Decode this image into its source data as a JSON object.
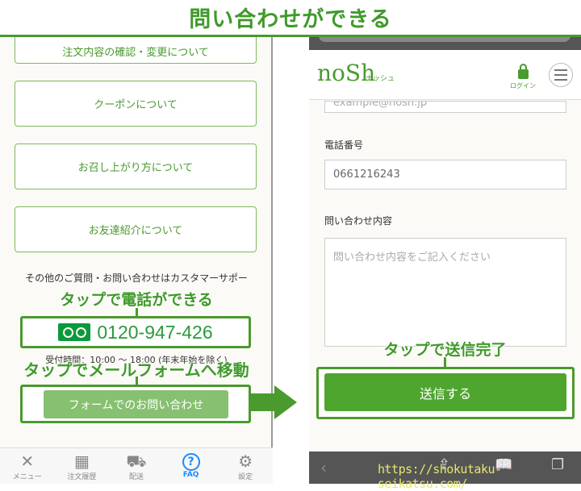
{
  "banner": "問い合わせができる",
  "left": {
    "faq_buttons": [
      "注文内容の確認・変更について",
      "クーポンについて",
      "お召し上がり方について",
      "お友達紹介について"
    ],
    "other_text": "その他のご質問・お問い合わせはカスタマーサポー",
    "phone": "0120-947-426",
    "hours": "受付時間：10:00 〜 18:00 (年末年始を除く)",
    "form_button": "フォームでのお問い合わせ",
    "anno_phone": "タップで電話ができる",
    "anno_form": "タップでメールフォームへ移動",
    "tabs": [
      {
        "label": "メニュー",
        "icon": "utensils-icon"
      },
      {
        "label": "注文履歴",
        "icon": "calendar-icon"
      },
      {
        "label": "配送",
        "icon": "truck-icon"
      },
      {
        "label": "FAQ",
        "icon": "question-icon",
        "active": true
      },
      {
        "label": "設定",
        "icon": "gear-icon"
      }
    ],
    "active_color": "#1a8cff"
  },
  "right": {
    "logo": "noSh",
    "logo_kana": "ナッシュ",
    "login": "ログイン",
    "email_value": "example@nosh.jp",
    "phone_label": "電話番号",
    "phone_value": "0661216243",
    "inquiry_label": "問い合わせ内容",
    "inquiry_placeholder": "問い合わせ内容をご記入ください",
    "submit": "送信する",
    "anno_submit": "タップで送信完了",
    "url": "https://shokutaku-seikatsu.com/"
  },
  "colors": {
    "accent": "#4a9a2e",
    "submit": "#4ea62f"
  }
}
